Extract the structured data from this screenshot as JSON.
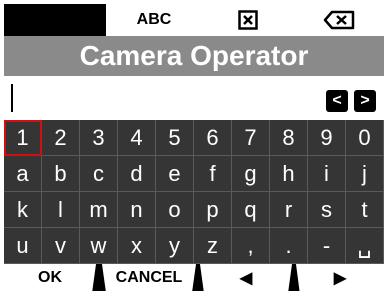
{
  "tabs": {
    "abc_label": "ABC",
    "clear_icon": "x-box-icon",
    "backspace_icon": "backspace-icon"
  },
  "title": "Camera Operator",
  "input": {
    "value": "",
    "left_arrow": "<",
    "right_arrow": ">"
  },
  "keyboard": {
    "rows": [
      [
        "1",
        "2",
        "3",
        "4",
        "5",
        "6",
        "7",
        "8",
        "9",
        "0"
      ],
      [
        "a",
        "b",
        "c",
        "d",
        "e",
        "f",
        "g",
        "h",
        "i",
        "j"
      ],
      [
        "k",
        "l",
        "m",
        "n",
        "o",
        "p",
        "q",
        "r",
        "s",
        "t"
      ],
      [
        "u",
        "v",
        "w",
        "x",
        "y",
        "z",
        ",",
        ".",
        "-",
        "␣"
      ]
    ],
    "selected": "1"
  },
  "bottom": {
    "ok": "OK",
    "cancel": "CANCEL",
    "left": "◀",
    "right": "▶"
  },
  "colors": {
    "title_bg": "#8a8a8a",
    "key_bg": "#353535",
    "selected_outline": "#d01010"
  }
}
